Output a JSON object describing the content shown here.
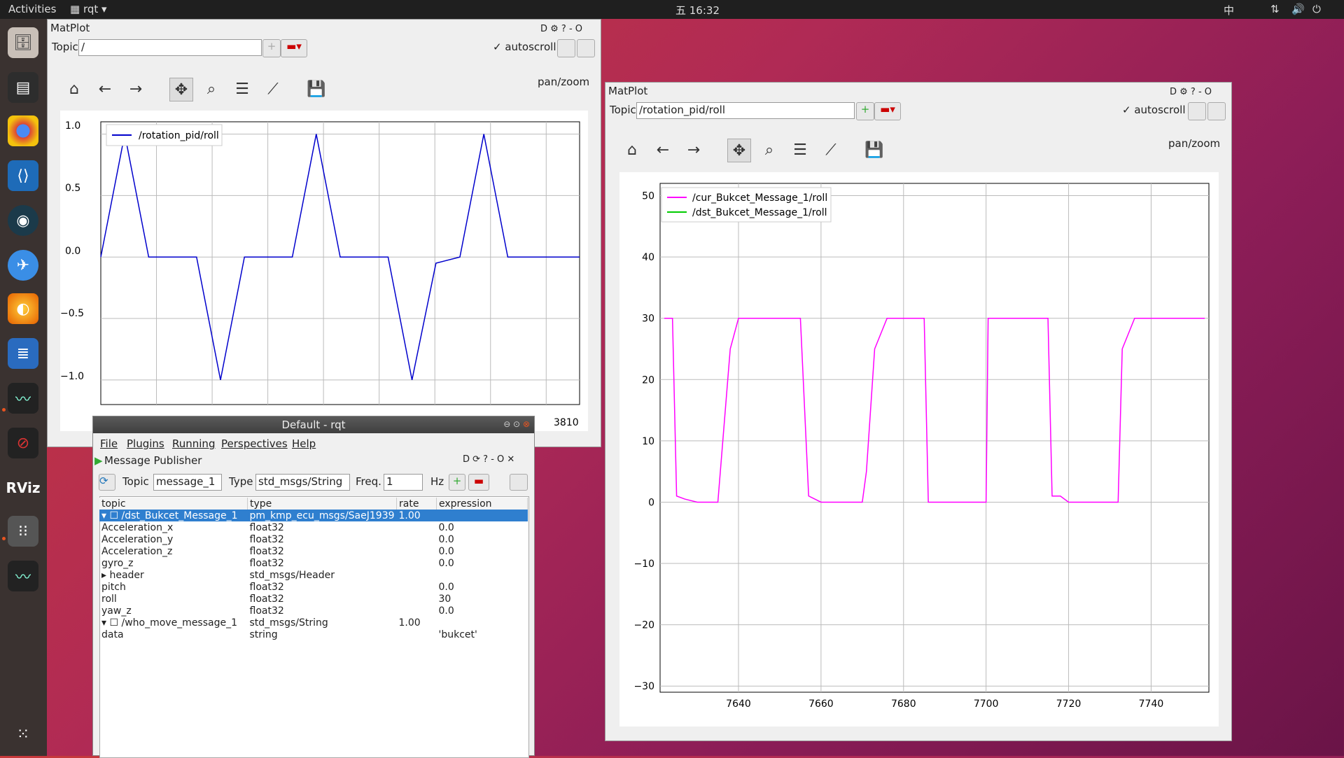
{
  "topbar": {
    "activities": "Activities",
    "app": "rqt",
    "time": "五 16:32",
    "ime": "中"
  },
  "left_window": {
    "title": "MatPlot",
    "topic_label": "Topic",
    "topic_value": "/",
    "autoscroll": "autoscroll",
    "mode": "pan/zoom",
    "x_tick_right": "3810",
    "y_ticks": [
      "1.0",
      "0.5",
      "0.0",
      "−0.5",
      "−1.0"
    ]
  },
  "right_window": {
    "title": "MatPlot",
    "topic_label": "Topic",
    "topic_value": "/rotation_pid/roll",
    "autoscroll": "autoscroll",
    "mode": "pan/zoom",
    "y_ticks": [
      "50",
      "40",
      "30",
      "20",
      "10",
      "0",
      "−10",
      "−20",
      "−30"
    ],
    "x_ticks": [
      "7640",
      "7660",
      "7680",
      "7700",
      "7720",
      "7740"
    ]
  },
  "chart_data": [
    {
      "type": "line",
      "series": [
        {
          "name": "/rotation_pid/roll",
          "color": "#0000cc",
          "values": [
            0,
            1,
            0,
            0,
            0,
            -1,
            0,
            0,
            0,
            1,
            0,
            0,
            0,
            -1,
            -0.05,
            0,
            1,
            0,
            0,
            0,
            0
          ]
        }
      ],
      "ylim": [
        -1.2,
        1.1
      ],
      "grid": true,
      "legend": "top-left"
    },
    {
      "type": "line",
      "series": [
        {
          "name": "/cur_Bukcet_Message_1/roll",
          "color": "#ff00ff",
          "x": [
            7622,
            7624,
            7625,
            7627,
            7630,
            7635,
            7638,
            7640,
            7650,
            7655,
            7657,
            7660,
            7670,
            7671,
            7673,
            7676,
            7685,
            7686,
            7700,
            7700.5,
            7703,
            7715,
            7716,
            7718,
            7720,
            7725,
            7732,
            7733,
            7736,
            7740,
            7753
          ],
          "y": [
            30,
            30,
            1,
            0.5,
            0,
            0,
            25,
            30,
            30,
            30,
            1,
            0,
            0,
            5,
            25,
            30,
            30,
            0,
            0,
            30,
            30,
            30,
            1,
            1,
            0,
            0,
            0,
            25,
            30,
            30,
            30
          ]
        },
        {
          "name": "/dst_Bukcet_Message_1/roll",
          "color": "#00cc00",
          "x": [],
          "y": []
        }
      ],
      "ylim": [
        -31,
        52
      ],
      "xlim": [
        7621,
        7754
      ],
      "grid": true,
      "legend": "top-left"
    }
  ],
  "rqt": {
    "title": "Default - rqt",
    "menu": [
      "File",
      "Plugins",
      "Running",
      "Perspectives",
      "Help"
    ],
    "plugin": "Message Publisher",
    "topic_label": "Topic",
    "topic_value": "message_1",
    "type_label": "Type",
    "type_value": "std_msgs/String",
    "freq_label": "Freq.",
    "freq_value": "1",
    "hz": "Hz",
    "columns": [
      "topic",
      "type",
      "rate",
      "expression"
    ],
    "rows": [
      [
        "/dst_Bukcet_Message_1",
        "pm_kmp_ecu_msgs/SaeJ1939",
        "1.00",
        ""
      ],
      [
        "Acceleration_x",
        "float32",
        "",
        "0.0"
      ],
      [
        "Acceleration_y",
        "float32",
        "",
        "0.0"
      ],
      [
        "Acceleration_z",
        "float32",
        "",
        "0.0"
      ],
      [
        "gyro_z",
        "float32",
        "",
        "0.0"
      ],
      [
        "header",
        "std_msgs/Header",
        "",
        ""
      ],
      [
        "pitch",
        "float32",
        "",
        "0.0"
      ],
      [
        "roll",
        "float32",
        "",
        "30"
      ],
      [
        "yaw_z",
        "float32",
        "",
        "0.0"
      ],
      [
        "/who_move_message_1",
        "std_msgs/String",
        "1.00",
        ""
      ],
      [
        "data",
        "string",
        "",
        "'bukcet'"
      ]
    ]
  }
}
